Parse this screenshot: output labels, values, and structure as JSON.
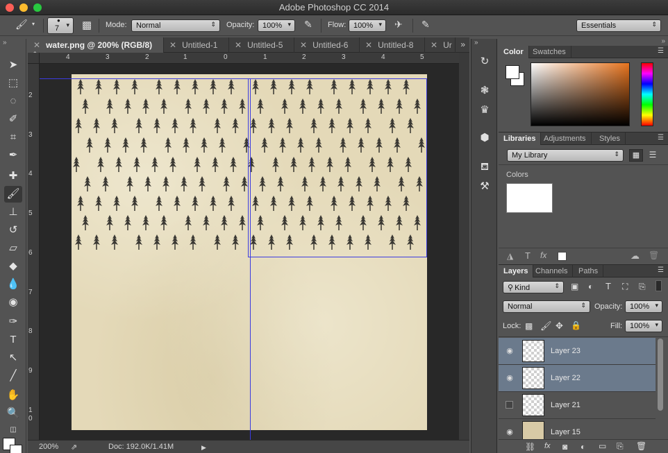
{
  "window": {
    "title": "Adobe Photoshop CC 2014"
  },
  "options_bar": {
    "brush_size": "7",
    "mode_label": "Mode:",
    "mode_value": "Normal",
    "opacity_label": "Opacity:",
    "opacity_value": "100%",
    "flow_label": "Flow:",
    "flow_value": "100%",
    "workspace": "Essentials"
  },
  "tabs": [
    {
      "label": "water.png @ 200% (RGB/8) *",
      "active": true
    },
    {
      "label": "Untitled-1"
    },
    {
      "label": "Untitled-5"
    },
    {
      "label": "Untitled-6"
    },
    {
      "label": "Untitled-8"
    },
    {
      "label": "Ur"
    }
  ],
  "rulers": {
    "top": [
      "4",
      "3",
      "2",
      "1",
      "0",
      "1",
      "2",
      "3",
      "4",
      "5"
    ],
    "left": [
      "2",
      "3",
      "4",
      "5",
      "6",
      "7",
      "8",
      "9",
      "1",
      "0"
    ]
  },
  "status": {
    "zoom": "200%",
    "doc": "Doc: 192.0K/1.41M"
  },
  "color_panel": {
    "tabs": [
      "Color",
      "Swatches"
    ]
  },
  "libraries_panel": {
    "tabs": [
      "Libraries",
      "Adjustments",
      "Styles"
    ],
    "library": "My Library",
    "section": "Colors"
  },
  "layers_panel": {
    "tabs": [
      "Layers",
      "Channels",
      "Paths"
    ],
    "filter": "Kind",
    "blend_mode": "Normal",
    "opacity_label": "Opacity:",
    "opacity_value": "100%",
    "lock_label": "Lock:",
    "fill_label": "Fill:",
    "fill_value": "100%",
    "layers": [
      {
        "name": "Layer 23",
        "visible": true,
        "selected": true
      },
      {
        "name": "Layer 22",
        "visible": true,
        "selected": true
      },
      {
        "name": "Layer 21",
        "visible": false,
        "selected": false
      },
      {
        "name": "Layer 15",
        "visible": true,
        "selected": false
      }
    ]
  },
  "colors": {
    "accent_guide": "#3b3be0",
    "selected_layer": "#6b7a8c",
    "paper": "#e4d9b8"
  }
}
